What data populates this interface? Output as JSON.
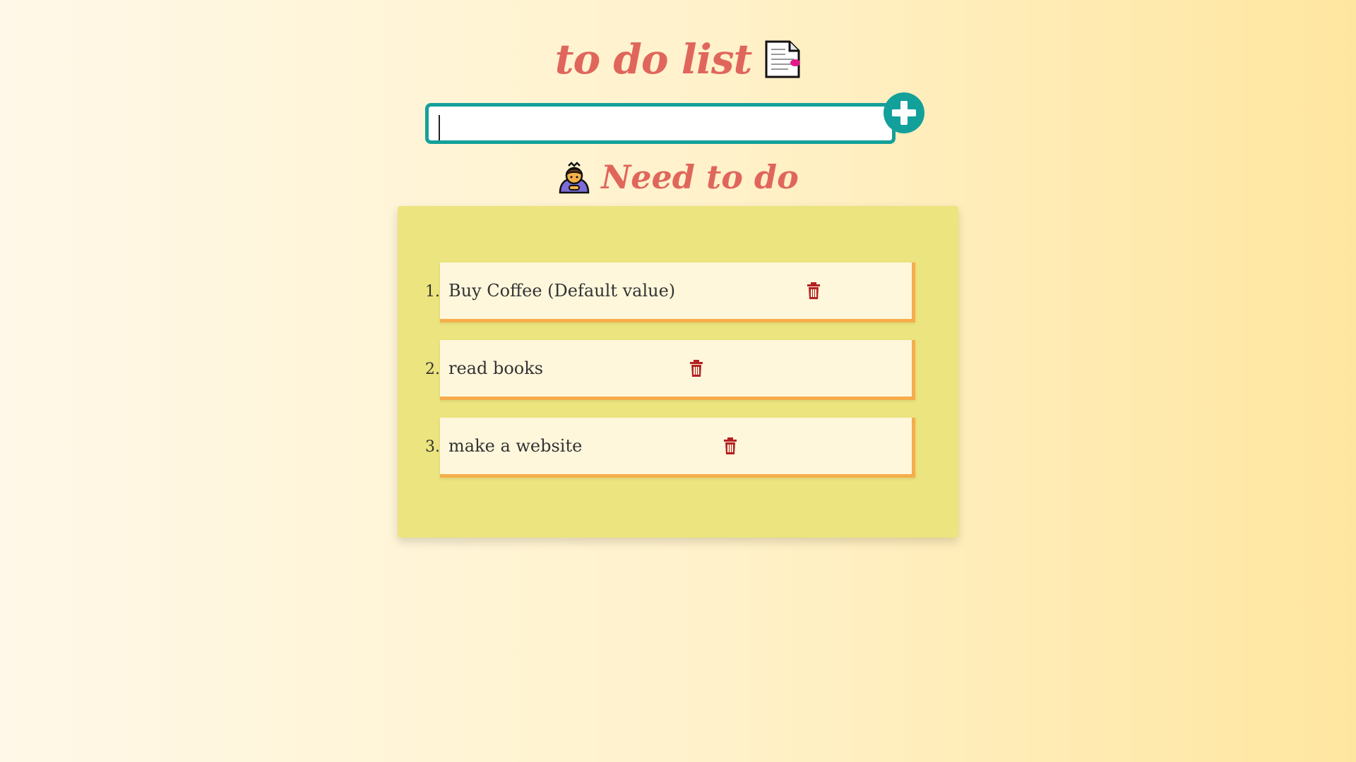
{
  "header": {
    "title": "to do list",
    "title_icon": "document-icon"
  },
  "input": {
    "value": "",
    "placeholder": ""
  },
  "add_button": {
    "icon": "plus-icon"
  },
  "section": {
    "title": "Need to do",
    "icon": "person-bowing-icon"
  },
  "colors": {
    "accent": "#14a09a",
    "title": "#e0665c",
    "panel": "#ece47e",
    "card": "#fff7dc",
    "card_border": "#f6ad4a",
    "delete": "#b32020"
  },
  "todos": [
    {
      "number": "1.",
      "text": "Buy Coffee (Default value)",
      "delete_icon": "trash-icon"
    },
    {
      "number": "2.",
      "text": "read books",
      "delete_icon": "trash-icon"
    },
    {
      "number": "3.",
      "text": "make a website",
      "delete_icon": "trash-icon"
    }
  ]
}
